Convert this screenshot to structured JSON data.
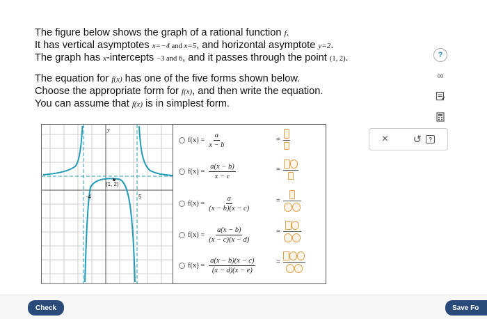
{
  "question": {
    "l1a": "The figure below shows the graph of a rational function ",
    "l1f": "f",
    "l1b": ".",
    "l2a": "It has vertical asymptotes ",
    "l2v1": "x=−4",
    "l2and": " and ",
    "l2v2": "x=5",
    "l2b": ", and horizontal asymptote ",
    "l2h": "y=2",
    "l2c": ".",
    "l3a": "The graph has ",
    "l3x": "x",
    "l3b": "-intercepts ",
    "l3i": "−3 and 6",
    "l3c": ", and it passes through the point ",
    "l3p": "(1, 2)",
    "l3d": ".",
    "l4a": "The equation for ",
    "l4f": "f(x)",
    "l4b": " has one of the five forms shown below.",
    "l5a": "Choose the appropriate form for ",
    "l5f": "f(x)",
    "l5b": ", and then write the equation.",
    "l6a": "You can assume that ",
    "l6f": "f(x)",
    "l6b": " is in simplest form."
  },
  "options": [
    {
      "lhs": "f(x) =",
      "num": "a",
      "den": "x − b"
    },
    {
      "lhs": "f(x) =",
      "num": "a(x − b)",
      "den": "x − c"
    },
    {
      "lhs": "f(x) =",
      "num": "a",
      "den": "(x − b)(x − c)"
    },
    {
      "lhs": "f(x) =",
      "num": "a(x − b)",
      "den": "(x − c)(x − d)"
    },
    {
      "lhs": "f(x) =",
      "num": "a(x − b)(x − c)",
      "den": "(x − d)(x − e)"
    }
  ],
  "graph": {
    "point_label": "(1, 2)",
    "tick_neg4": "-4",
    "tick_5": "5"
  },
  "toolbar": {
    "clear": "×",
    "undo": "↺",
    "help": "?"
  },
  "side": {
    "help": "?",
    "infinity": "∞"
  },
  "buttons": {
    "check": "Check",
    "save": "Save Fo"
  },
  "colors": {
    "curve": "#1f9bb5",
    "accent": "#2a4a7a",
    "box": "#e0a14b"
  },
  "icons": [
    "question-icon",
    "infinity-icon",
    "notepad-icon",
    "calculator-icon",
    "close-icon",
    "undo-icon",
    "help-icon"
  ]
}
